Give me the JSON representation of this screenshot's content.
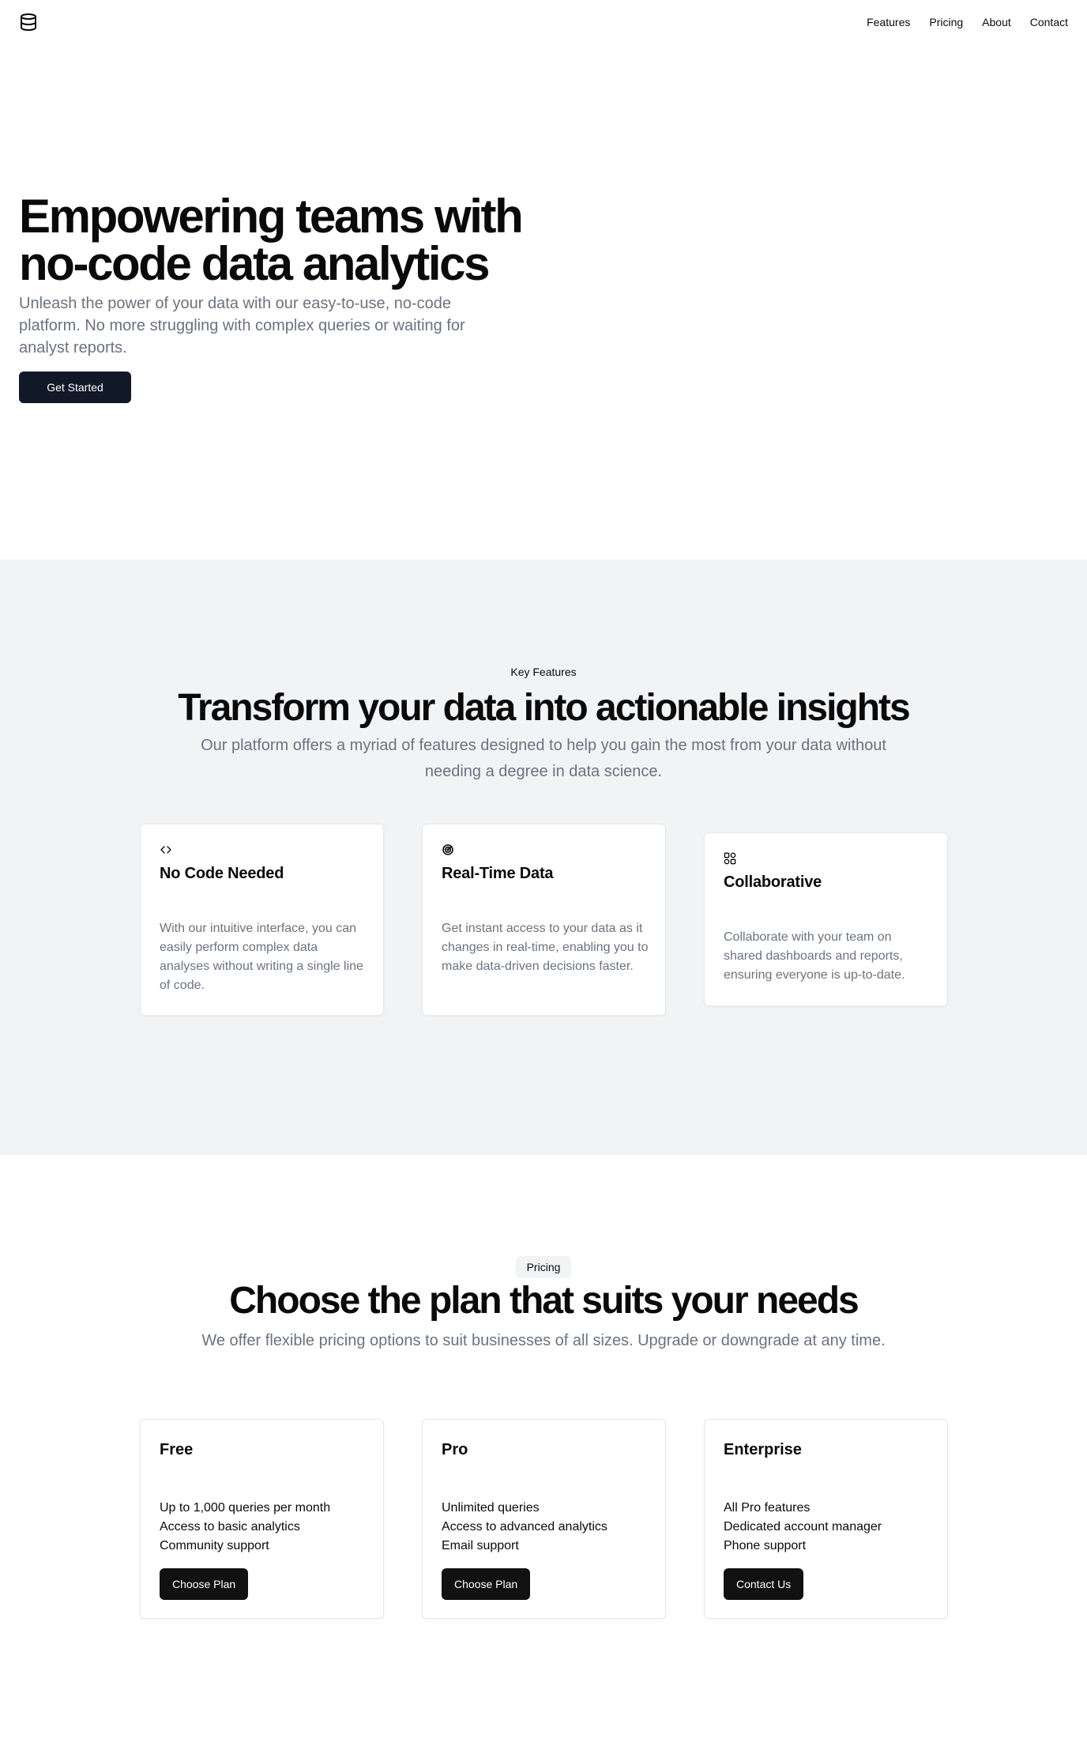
{
  "header": {
    "logo_icon": "database-icon",
    "nav": [
      {
        "label": "Features"
      },
      {
        "label": "Pricing"
      },
      {
        "label": "About"
      },
      {
        "label": "Contact"
      }
    ]
  },
  "hero": {
    "title_line1": "Empowering teams with",
    "title_line2": "no-code data analytics",
    "subtitle": "Unleash the power of your data with our easy-to-use, no-code platform. No more struggling with complex queries or waiting for analyst reports.",
    "cta_label": "Get Started"
  },
  "features": {
    "eyebrow": "Key Features",
    "title": "Transform your data into actionable insights",
    "subtitle": "Our platform offers a myriad of features designed to help you gain the most from your data without needing a degree in data science.",
    "cards": [
      {
        "icon": "code-icon",
        "title": "No Code Needed",
        "description": "With our intuitive interface, you can easily perform complex data analyses without writing a single line of code."
      },
      {
        "icon": "radar-icon",
        "title": "Real-Time Data",
        "description": "Get instant access to your data as it changes in real-time, enabling you to make data-driven decisions faster."
      },
      {
        "icon": "collaboration-icon",
        "title": "Collaborative",
        "description": "Collaborate with your team on shared dashboards and reports, ensuring everyone is up-to-date."
      }
    ]
  },
  "pricing": {
    "eyebrow": "Pricing",
    "title": "Choose the plan that suits your needs",
    "subtitle": "We offer flexible pricing options to suit businesses of all sizes. Upgrade or downgrade at any time.",
    "plans": [
      {
        "name": "Free",
        "features": [
          "Up to 1,000 queries per month",
          "Access to basic analytics",
          "Community support"
        ],
        "cta": "Choose Plan"
      },
      {
        "name": "Pro",
        "features": [
          "Unlimited queries",
          "Access to advanced analytics",
          "Email support"
        ],
        "cta": "Choose Plan"
      },
      {
        "name": "Enterprise",
        "features": [
          "All Pro features",
          "Dedicated account manager",
          "Phone support"
        ],
        "cta": "Contact Us"
      }
    ]
  },
  "colors": {
    "primary_button": "#111827",
    "section_bg": "#f2f3f5",
    "muted_text": "#6b7280"
  }
}
